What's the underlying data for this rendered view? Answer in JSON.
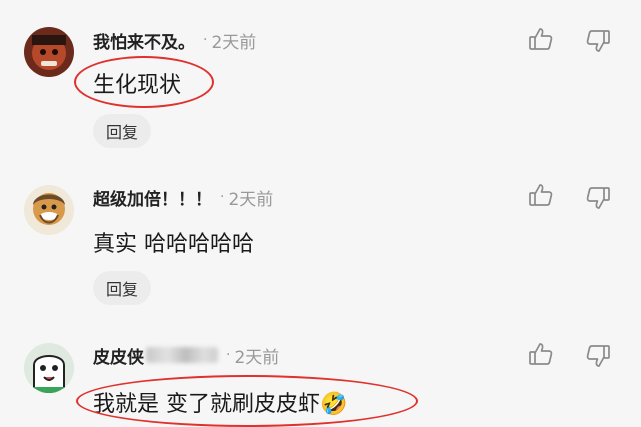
{
  "comments": [
    {
      "username": "我怕来不及。",
      "dot": "·",
      "time": "2天前",
      "text": "生化现状",
      "reply_label": "回复"
    },
    {
      "username": "超级加倍！！！",
      "dot": "·",
      "time": "2天前",
      "text": "真实 哈哈哈哈哈",
      "reply_label": "回复"
    },
    {
      "username": "皮皮侠",
      "dot": "·",
      "time": "2天前",
      "text": "我就是  变了就刷皮皮虾",
      "emoji": "🤣"
    }
  ],
  "icons": {
    "like": "thumbs-up-icon",
    "dislike": "thumbs-down-icon"
  },
  "colors": {
    "highlight_ring": "#e0312d",
    "background": "#f6f6f6",
    "reply_bg": "#ececec"
  }
}
